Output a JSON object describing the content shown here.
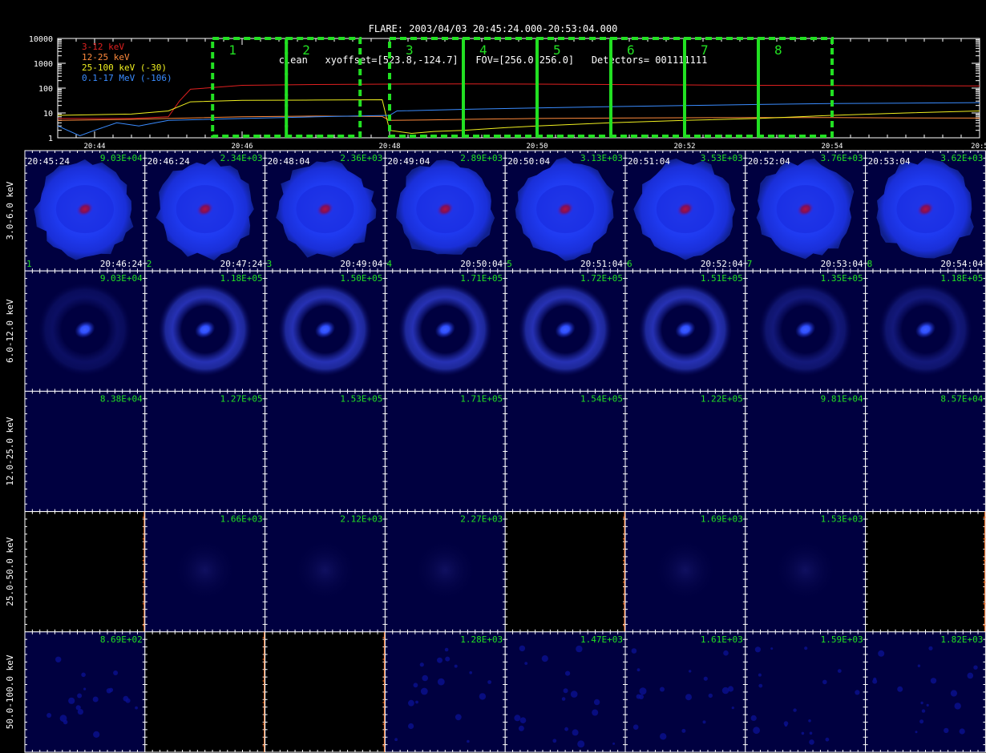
{
  "header": {
    "line1": "FLARE: 2003/04/03 20:45:24.000-20:53:04.000",
    "line2": "clean   xyoffset=[523.8,-124.7]   FOV=[256.0,256.0]   Detectors= 001111111"
  },
  "chart_data": [
    {
      "type": "line",
      "yscale": "log",
      "ylim": [
        1,
        10000
      ],
      "yticks": [
        "1",
        "10",
        "100",
        "1000",
        "10000"
      ],
      "xticks": [
        "20:44",
        "20:46",
        "20:48",
        "20:50",
        "20:52",
        "20:54",
        "20:5"
      ],
      "xlim_min": [
        43.5,
        56.0
      ],
      "legend_position": "top-left",
      "series": [
        {
          "name": "3-12 keV",
          "color": "#e02020",
          "x": [
            43.5,
            44.5,
            45.0,
            45.15,
            45.3,
            46.0,
            47.0,
            48.0,
            49.0,
            50.0,
            51.0,
            52.0,
            53.0,
            54.0,
            55.0,
            56.0
          ],
          "y": [
            6,
            6,
            7,
            30,
            90,
            130,
            140,
            145,
            148,
            145,
            140,
            135,
            130,
            128,
            125,
            122
          ]
        },
        {
          "name": "12-25 keV",
          "color": "#ff8a3c",
          "x": [
            43.5,
            44.5,
            45.0,
            46.0,
            47.0,
            47.9,
            48.0,
            48.5,
            49.0,
            50.0,
            51.0,
            52.0,
            53.0,
            54.0,
            55.0,
            56.0
          ],
          "y": [
            5,
            5.5,
            6,
            7,
            7.5,
            7.2,
            5,
            5.2,
            5.5,
            6,
            6.2,
            6.4,
            6.5,
            6.5,
            6.3,
            6.2
          ]
        },
        {
          "name": "25-100 keV (-30)",
          "color": "#f0f020",
          "x": [
            43.5,
            44.5,
            45.0,
            45.3,
            46.0,
            47.0,
            47.9,
            48.0,
            48.3,
            48.6,
            49.0,
            49.5,
            50.0,
            51.0,
            52.0,
            53.0,
            54.0,
            55.0,
            56.0
          ],
          "y": [
            8,
            9,
            12,
            28,
            32,
            33,
            34,
            2,
            1.5,
            1.8,
            2,
            2.5,
            3,
            4,
            5,
            6,
            8,
            10,
            12
          ]
        },
        {
          "name": "0.1-17 MeV (-106)",
          "color": "#3a8cff",
          "x": [
            43.5,
            43.8,
            44.0,
            44.3,
            44.6,
            45.0,
            46.0,
            47.0,
            48.0,
            48.1,
            49.0,
            50.0,
            51.0,
            52.0,
            53.0,
            54.0,
            55.0,
            56.0
          ],
          "y": [
            3,
            1.2,
            2,
            4,
            3,
            5,
            6,
            7,
            8,
            12,
            14,
            16,
            18,
            20,
            22,
            24,
            25,
            26
          ]
        }
      ],
      "intervals": [
        {
          "label": "1",
          "start": 45.6,
          "end": 46.6
        },
        {
          "label": "2",
          "start": 46.6,
          "end": 47.6
        },
        {
          "label": "3",
          "start": 48.0,
          "end": 49.0
        },
        {
          "label": "4",
          "start": 49.0,
          "end": 50.0
        },
        {
          "label": "5",
          "start": 50.0,
          "end": 51.0
        },
        {
          "label": "6",
          "start": 51.0,
          "end": 52.0
        },
        {
          "label": "7",
          "start": 52.0,
          "end": 53.0
        },
        {
          "label": "8",
          "start": 53.0,
          "end": 54.0
        }
      ],
      "interval_color": "#22e022"
    },
    {
      "type": "heatmap",
      "columns": [
        {
          "index": "1",
          "start": "20:45:24",
          "end": "20:46:24"
        },
        {
          "index": "2",
          "start": "20:46:24",
          "end": "20:47:24"
        },
        {
          "index": "3",
          "start": "20:48:04",
          "end": "20:49:04"
        },
        {
          "index": "4",
          "start": "20:49:04",
          "end": "20:50:04"
        },
        {
          "index": "5",
          "start": "20:50:04",
          "end": "20:51:04"
        },
        {
          "index": "6",
          "start": "20:51:04",
          "end": "20:52:04"
        },
        {
          "index": "7",
          "start": "20:52:04",
          "end": "20:53:04"
        },
        {
          "index": "8",
          "start": "20:53:04",
          "end": "20:54:04"
        }
      ],
      "rows": [
        {
          "label": "3.0-6.0  keV",
          "kind": "disk",
          "maxima": [
            "9.03E+04",
            "2.34E+03",
            "2.36E+03",
            "2.89E+03",
            "3.13E+03",
            "3.53E+03",
            "3.76E+03",
            "3.62E+03"
          ]
        },
        {
          "label": "6.0-12.0  keV",
          "kind": "ring",
          "maxima": [
            "9.03E+04",
            "1.18E+05",
            "1.50E+05",
            "1.71E+05",
            "1.72E+05",
            "1.51E+05",
            "1.35E+05",
            "1.18E+05"
          ]
        },
        {
          "label": "12.0-25.0  keV",
          "kind": "empty",
          "maxima": [
            "8.38E+04",
            "1.27E+05",
            "1.53E+05",
            "1.71E+05",
            "1.54E+05",
            "1.22E+05",
            "9.81E+04",
            "8.57E+04"
          ]
        },
        {
          "label": "25.0-50.0  keV",
          "kind": "faint",
          "maxima": [
            "",
            "1.66E+03",
            "2.12E+03",
            "2.27E+03",
            "",
            "1.69E+03",
            "1.53E+03",
            ""
          ],
          "blank": [
            0,
            4,
            7
          ]
        },
        {
          "label": "50.0-100.0  keV",
          "kind": "noise",
          "maxima": [
            "8.69E+02",
            "",
            "",
            "1.28E+03",
            "1.47E+03",
            "1.61E+03",
            "1.59E+03",
            "1.82E+03"
          ],
          "blank": [
            1,
            2
          ]
        }
      ],
      "label_color": "#22e022",
      "panel_color": "#000040"
    }
  ]
}
